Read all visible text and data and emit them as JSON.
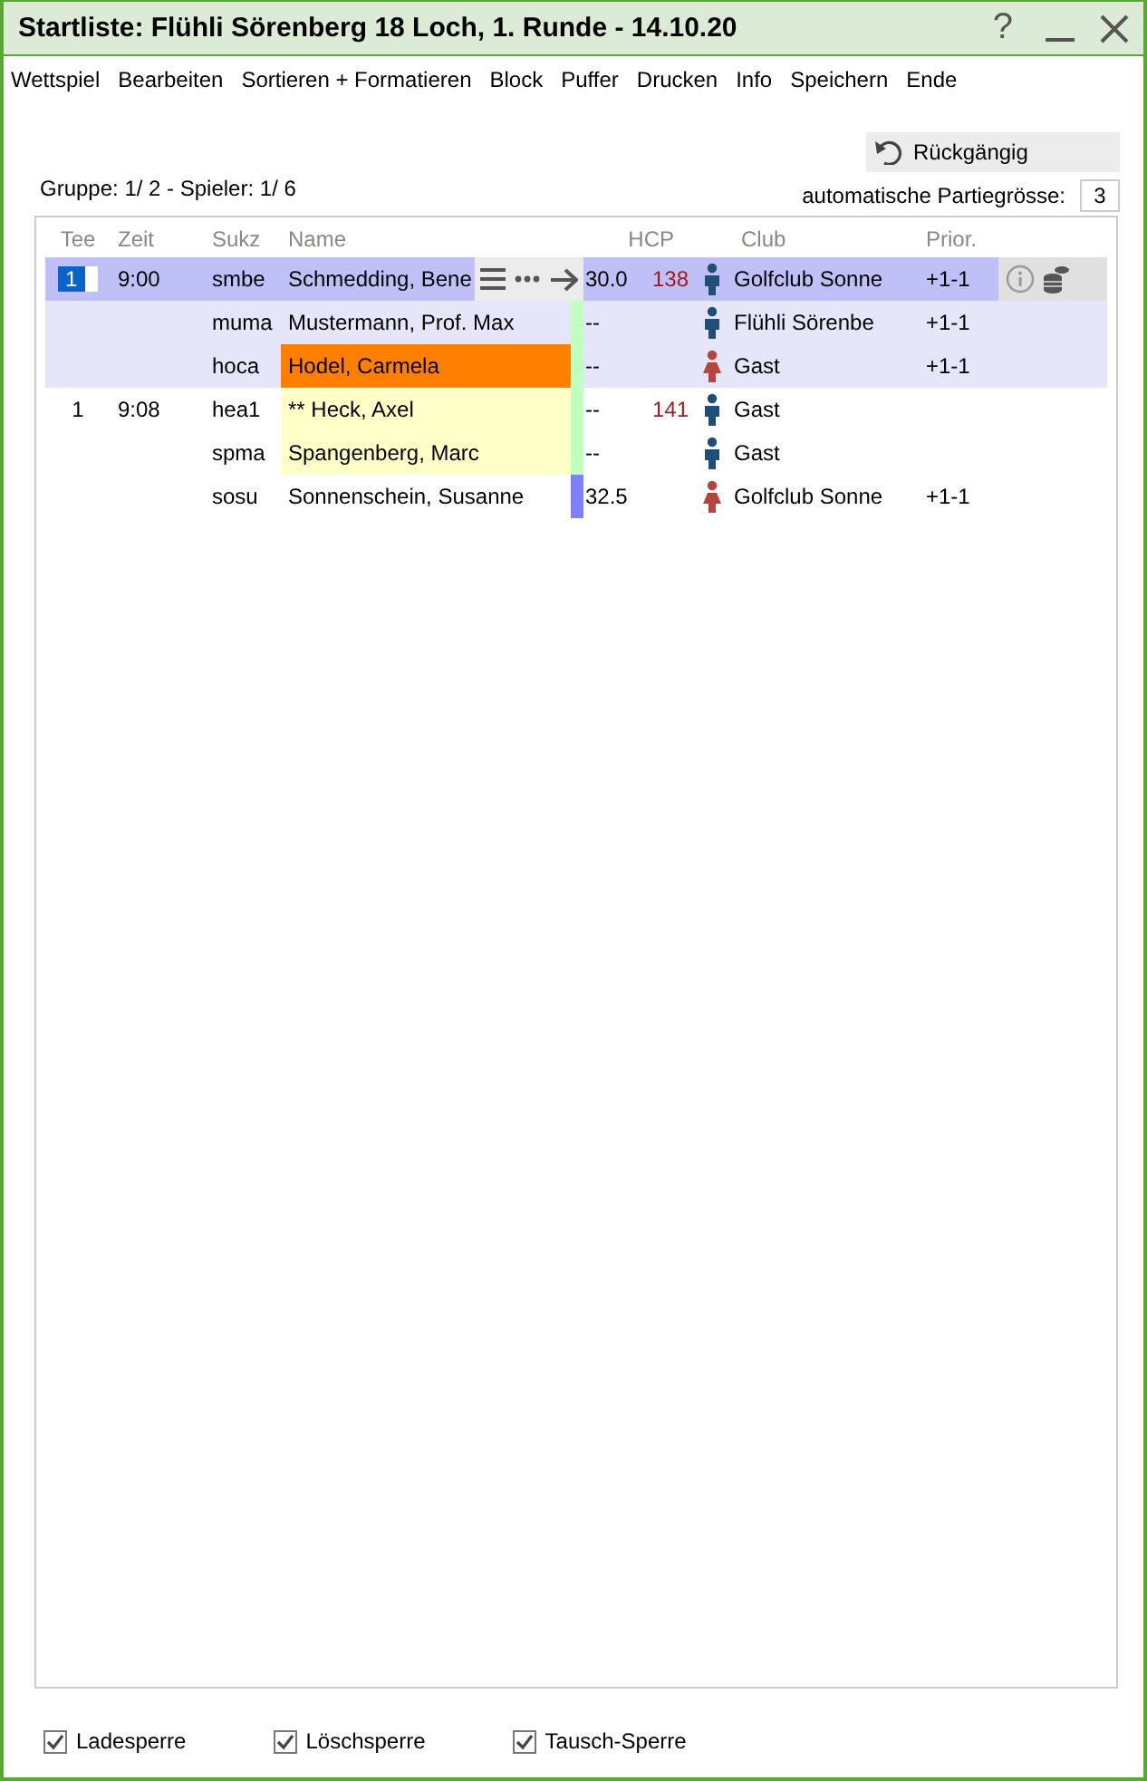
{
  "window": {
    "title": "Startliste: Flühli Sörenberg 18 Loch, 1. Runde - 14.10.20",
    "help": "?"
  },
  "menu": [
    "Wettspiel",
    "Bearbeiten",
    "Sortieren + Formatieren",
    "Block",
    "Puffer",
    "Drucken",
    "Info",
    "Speichern",
    "Ende"
  ],
  "status_text": "Gruppe:   1/  2 - Spieler:  1/  6",
  "undo_button": "Rückgängig",
  "group_size": {
    "label": "automatische Partiegrösse:",
    "value": "3"
  },
  "table": {
    "columns": [
      "Tee",
      "Zeit",
      "Sukz",
      "Name",
      "HCP",
      "Club",
      "Prior."
    ],
    "groups": [
      {
        "highlighted": true,
        "rows": [
          {
            "tee": "1",
            "time": "9:00",
            "code": "smbe",
            "name": "Schmedding, Bene",
            "hcp": "30.0",
            "index": "138",
            "kind": "male",
            "club": "Golfclub Sonne",
            "prior": "+1-1",
            "selected": true
          },
          {
            "code": "muma",
            "name": "Mustermann, Prof. Max",
            "hcp": "--",
            "kind": "male",
            "club": "Flühli Sörenbe",
            "prior": "+1-1",
            "selected": false,
            "strip": {
              "color": "#c0ffc0"
            }
          },
          {
            "code": "hoca",
            "name": "Hodel, Carmela",
            "hcp": "--",
            "kind": "female",
            "club": "Gast",
            "prior": "+1-1",
            "selected": false,
            "name_fill": {
              "color": "#ff8000"
            },
            "strip": {
              "color": "#c0ffc0"
            }
          }
        ]
      },
      {
        "highlighted": false,
        "rows": [
          {
            "tee": "1",
            "time": "9:08",
            "code": "hea1",
            "name": "** Heck, Axel",
            "hcp": "--",
            "index": "141",
            "kind": "male",
            "club": "Gast",
            "selected": false,
            "name_fill": {
              "color": "#ffffc8"
            },
            "strip": {
              "color": "#c0ffc0"
            }
          },
          {
            "code": "spma",
            "name": "Spangenberg, Marc",
            "hcp": "--",
            "kind": "male",
            "club": "Gast",
            "selected": false,
            "name_fill": {
              "color": "#ffffc8"
            },
            "strip": {
              "color": "#c0ffc0"
            }
          },
          {
            "code": "sosu",
            "name": "Sonnenschein, Susanne",
            "hcp": "32.5",
            "kind": "female",
            "club": "Golfclub Sonne",
            "prior": "+1-1",
            "selected": false,
            "strip": {
              "color": "#8080ff"
            }
          }
        ]
      }
    ]
  },
  "checkboxes": [
    {
      "label": "Ladesperre",
      "checked": true
    },
    {
      "label": "Löschsperre",
      "checked": true
    },
    {
      "label": "Tausch-Sperre",
      "checked": true
    }
  ]
}
